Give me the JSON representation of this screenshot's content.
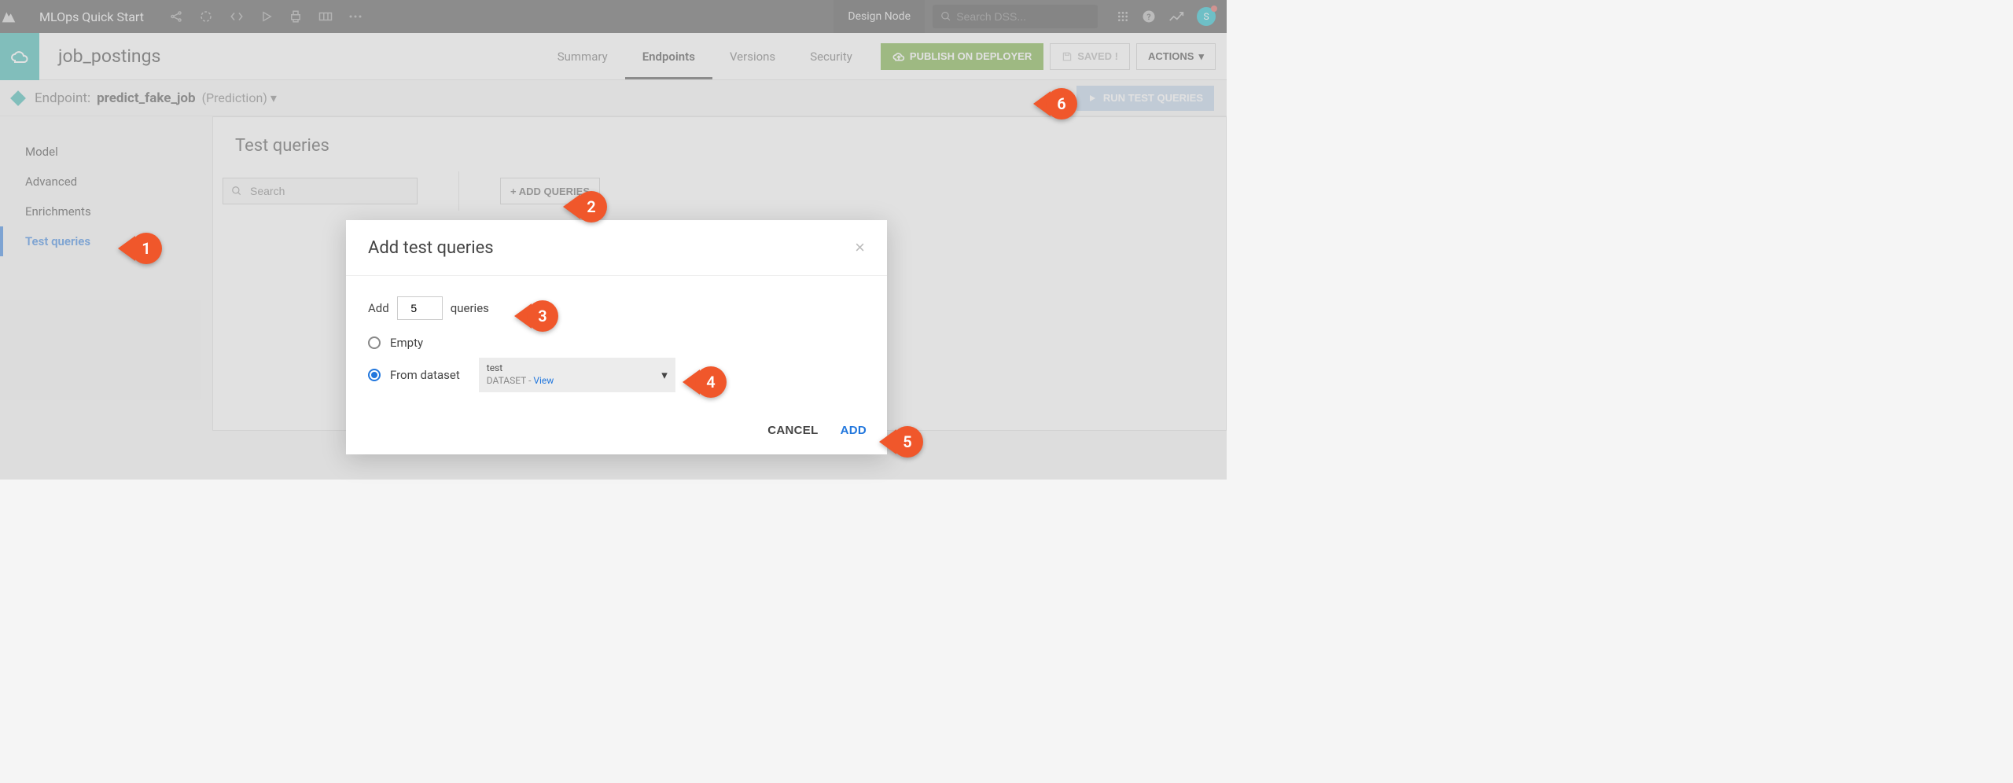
{
  "topbar": {
    "title": "MLOps Quick Start",
    "design_node": "Design Node",
    "search_placeholder": "Search DSS...",
    "avatar_letter": "S"
  },
  "secondbar": {
    "title": "job_postings",
    "tabs": [
      "Summary",
      "Endpoints",
      "Versions",
      "Security"
    ],
    "active_tab": "Endpoints",
    "publish_label": "PUBLISH ON DEPLOYER",
    "saved_label": "SAVED !",
    "actions_label": "ACTIONS"
  },
  "endpoint": {
    "prefix": "Endpoint:",
    "name": "predict_fake_job",
    "type": "(Prediction)",
    "run_label": "RUN TEST QUERIES"
  },
  "sidebar": {
    "items": [
      "Model",
      "Advanced",
      "Enrichments",
      "Test queries"
    ],
    "active": "Test queries"
  },
  "panel": {
    "heading": "Test queries",
    "search_placeholder": "Search",
    "add_queries_label": "+ ADD QUERIES"
  },
  "modal": {
    "title": "Add test queries",
    "add_prefix": "Add",
    "count_value": "5",
    "add_suffix": "queries",
    "option_empty": "Empty",
    "option_from_dataset": "From dataset",
    "dataset_name": "test",
    "dataset_sub_prefix": "DATASET - ",
    "dataset_view": "View",
    "cancel": "CANCEL",
    "add": "ADD"
  },
  "callouts": {
    "c1": "1",
    "c2": "2",
    "c3": "3",
    "c4": "4",
    "c5": "5",
    "c6": "6"
  }
}
